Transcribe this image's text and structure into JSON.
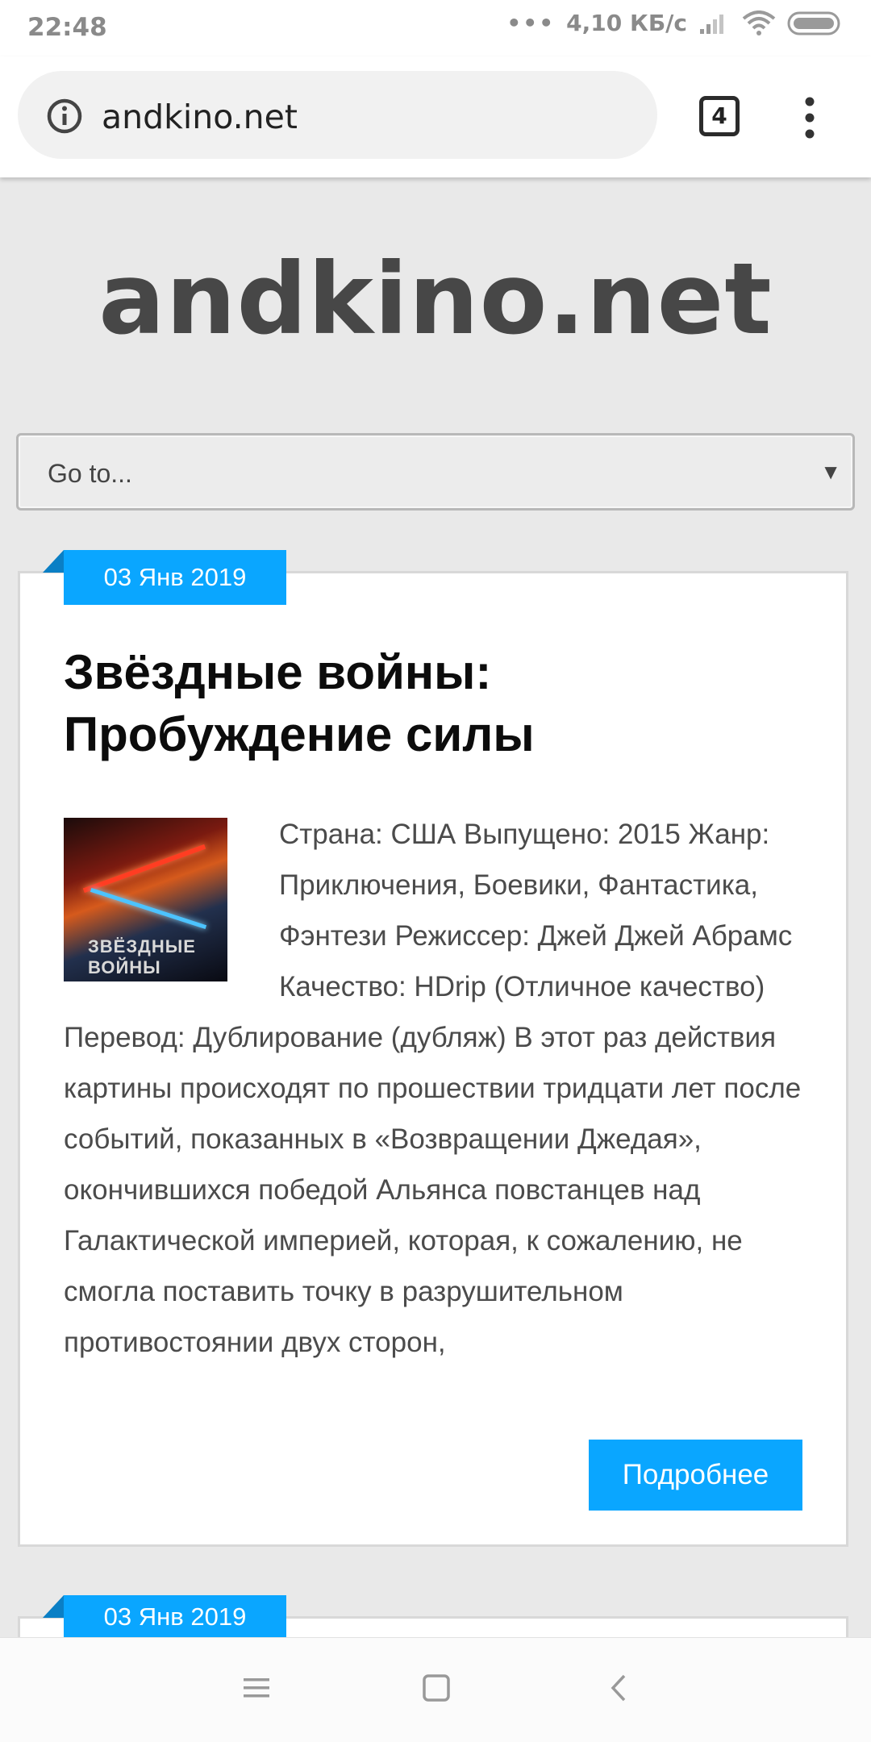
{
  "status_bar": {
    "time": "22:48",
    "dots": "•••",
    "network_speed": "4,10 КБ/с",
    "icons": [
      "signal-icon",
      "wifi-icon",
      "battery-icon"
    ]
  },
  "browser": {
    "url": "andkino.net",
    "tab_count": "4",
    "icons": [
      "info-icon",
      "tab-switcher-icon",
      "overflow-menu-icon"
    ]
  },
  "site": {
    "title": "andkino.net"
  },
  "navigation": {
    "select_value": "Go to...",
    "arrow": "▼"
  },
  "posts": [
    {
      "date": "03 Янв 2019",
      "title": "Звёздные войны: Пробуждение силы",
      "poster_text": "ЗВЁЗДНЫЕ ВОЙНЫ",
      "body": "Страна: США Выпущено: 2015 Жанр: Приключения, Боевики, Фантастика, Фэнтези Режиссер: Джей Джей Абрамс Качество: HDrip (Отличное качество) Перевод: Дублирование (дубляж) В этот раз действия картины происходят по прошествии тридцати лет после событий, показанных в «Возвращении Джедая», окончившихся победой Альянса повстанцев над Галактической империей, которая, к сожалению, не смогла поставить точку в разрушительном противостоянии двух сторон,",
      "more_label": "Подробнее"
    },
    {
      "date": "03 Янв 2019"
    }
  ],
  "colors": {
    "accent": "#0aa6ff",
    "page_background": "#e9e9e9",
    "title_text": "#474747"
  },
  "system_nav": {
    "icons": [
      "recents-icon",
      "home-icon",
      "back-icon"
    ]
  }
}
